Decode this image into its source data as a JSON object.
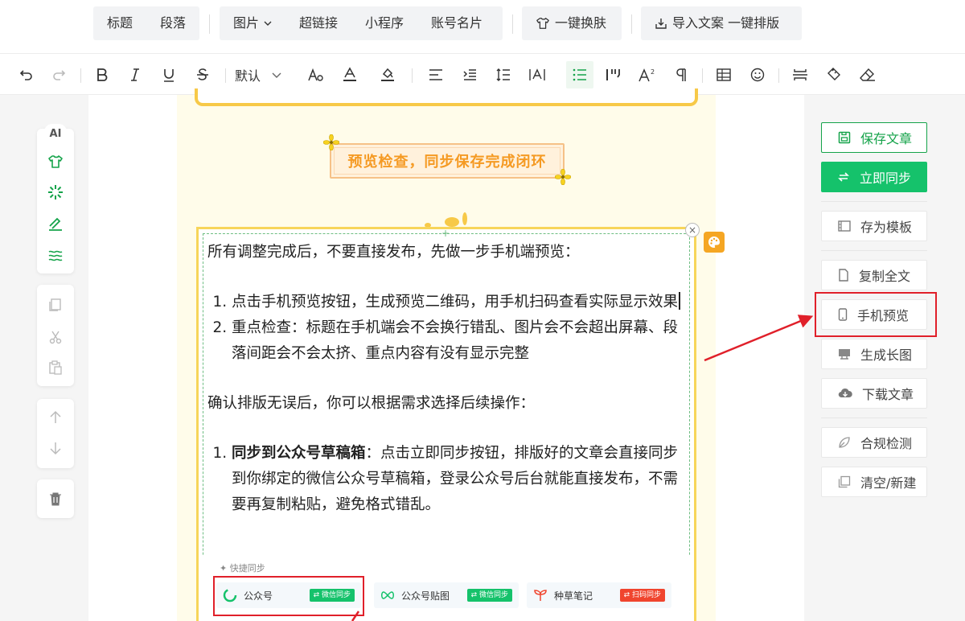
{
  "top_menu": {
    "heading": "标题",
    "paragraph": "段落",
    "image": "图片",
    "hyperlink": "超链接",
    "mini_program": "小程序",
    "account_card": "账号名片",
    "change_skin": "一键换肤",
    "import_text": "导入文案 一键排版"
  },
  "format_toolbar": {
    "font_default": "默认"
  },
  "left_tools": {
    "ai_label": "AI"
  },
  "article": {
    "section_title": "预览检查，同步保存完成闭环",
    "intro": "所有调整完成后，不要直接发布，先做一步手机端预览：",
    "steps": [
      "点击手机预览按钮，生成预览二维码，用手机扫码查看实际显示效果",
      "重点检查：标题在手机端会不会换行错乱、图片会不会超出屏幕、段落间距会不会太挤、重点内容有没有显示完整"
    ],
    "confirm": "确认排版无误后，你可以根据需求选择后续操作：",
    "option1_bold": "同步到公众号草稿箱",
    "option1_text": "：点击立即同步按钮，排版好的文章会直接同步到你绑定的微信公众号草稿箱，登录公众号后台就能直接发布，不需要再复制粘贴，避免格式错乱。"
  },
  "quick_sync": {
    "label": "快捷同步",
    "items": [
      {
        "name": "公众号",
        "tag": "微信同步",
        "tag_color": "#15c26b"
      },
      {
        "name": "公众号贴图",
        "tag": "微信同步",
        "tag_color": "#15c26b"
      },
      {
        "name": "种草笔记",
        "tag": "扫码同步",
        "tag_color": "#f0452e"
      }
    ]
  },
  "right_panel": {
    "save": "保存文章",
    "sync": "立即同步",
    "template": "存为模板",
    "copy_all": "复制全文",
    "mobile_preview": "手机预览",
    "long_image": "生成长图",
    "download": "下载文章",
    "compliance": "合规检测",
    "clear_new": "清空/新建"
  },
  "colors": {
    "brand_green": "#15c26b",
    "highlight_red": "#e0202a",
    "title_orange": "#f59a23"
  }
}
